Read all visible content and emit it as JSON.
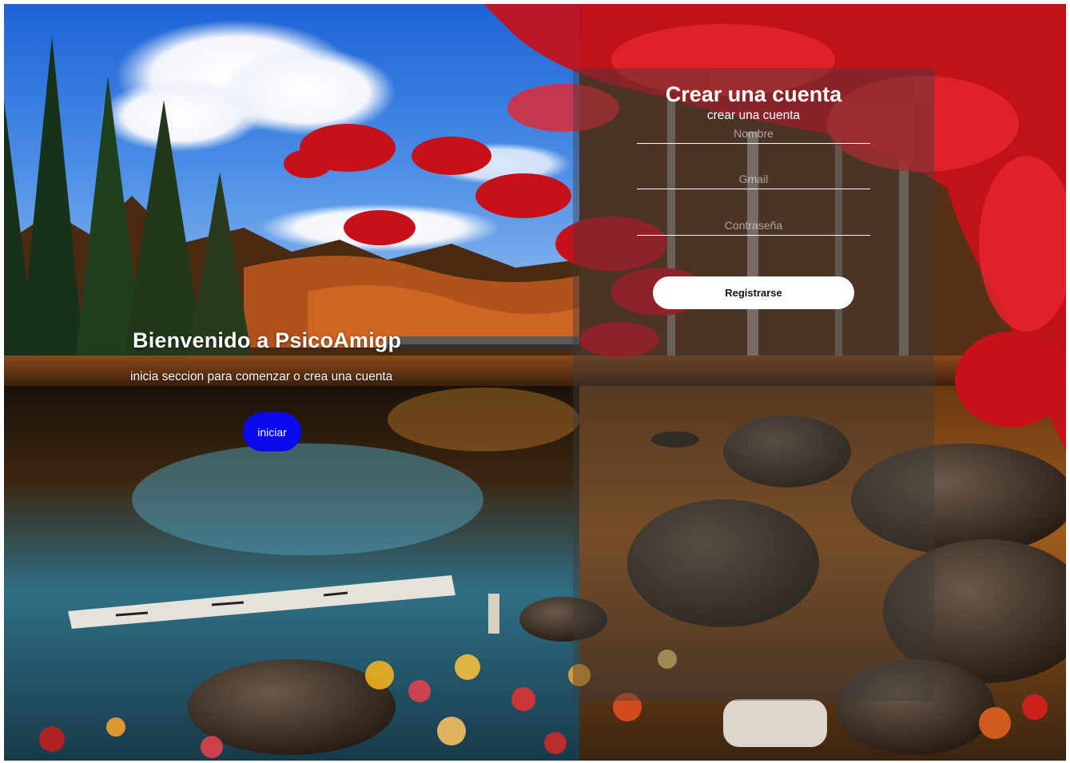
{
  "welcome": {
    "title": "Bienvenido a PsicoAmigp",
    "subtitle": "inicia seccion para comenzar o crea una cuenta",
    "login_label": "iniciar"
  },
  "signup": {
    "title": "Crear una cuenta",
    "subtitle": "crear una cuenta",
    "name_placeholder": "Nombre",
    "email_placeholder": "Gmail",
    "password_placeholder": "Contraseña",
    "register_label": "Registrarse"
  },
  "colors": {
    "login_button": "#0a0aee",
    "panel_overlay": "rgba(60,60,60,0.42)",
    "register_button": "#ffffff"
  }
}
